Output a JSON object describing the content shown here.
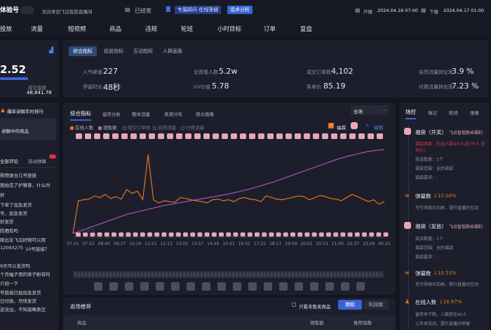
{
  "header": {
    "title": "体验号",
    "welcome": "欢迎来到飞瓜智投直播间",
    "status": "已结束",
    "tag_special": "专属顾问 在线答疑",
    "tag_analysis": "话术分析",
    "start_label": "开播",
    "start_time": "2024.04.16 07:00",
    "end_label": "下播",
    "end_time": "2024.04.17 01:00"
  },
  "nav": [
    "投放",
    "流量",
    "短视频",
    "商品",
    "违规",
    "轮班",
    "小时目标",
    "订单",
    "复盘"
  ],
  "left": {
    "big_value": "2.52",
    "sub_label": "GPM",
    "amount_label": "成交金额",
    "amount": "48,641.78",
    "rank_title": "爆单讲解实时排行",
    "explaining": "讲解中的商品",
    "comments_tab": "全部评论",
    "auto_tab": "自动弹幕",
    "comments": [
      "购物谁合几号链接",
      "我拍完了护臀膏，什么时",
      "好",
      "下单了加急发货",
      "号，加急发货",
      "好发货",
      "防晒有吗",
      "刚出生飞瓜好物可以用",
      "12093275",
      "10号链接？",
      "9天可以发货吗",
      "个月幅子用的痱子粉有吗",
      "介绍一下",
      "号链接已拍加急发货",
      "已付款，尽快发货",
      "还没出，不知道眯质怎"
    ]
  },
  "metrics": {
    "tabs": [
      "综合指标",
      "投放指标",
      "互动指标",
      "人群画像"
    ],
    "items": [
      {
        "label": "人气峰值",
        "value": "227"
      },
      {
        "label": "总观看人数",
        "value": "5.2w"
      },
      {
        "label": "成交订单数",
        "value": "4,102"
      },
      {
        "label": "自然流量转化率",
        "value": "3.9 %"
      },
      {
        "label": "停留时长",
        "value": "48秒"
      },
      {
        "label": "UV价值",
        "value": "5.78"
      },
      {
        "label": "客单价",
        "value": "85.19"
      },
      {
        "label": "付费流量转化率",
        "value": "7.23 %"
      }
    ]
  },
  "chart": {
    "tabs": [
      "综合指标",
      "留存分析",
      "整体流量",
      "来源分布",
      "观众画像"
    ],
    "select": "全场",
    "fudai_label": "福袋",
    "edit_label": "编辑",
    "legend": [
      {
        "name": "在线人数",
        "color": "#e0741f"
      },
      {
        "name": "销售额",
        "color": "#c65ad6"
      },
      {
        "name": "成交订单数",
        "color": "#5a6070"
      },
      {
        "name": "自然流量",
        "color": "#5a6070"
      },
      {
        "name": "付费流量",
        "color": "#5a6070"
      }
    ],
    "watermark": "飞瓜智投"
  },
  "chart_data": {
    "type": "line",
    "x_ticks": [
      "07:01",
      "07:53",
      "08:45",
      "09:37",
      "10:29",
      "11:21",
      "12:13",
      "13:05",
      "13:57",
      "14:49",
      "15:41",
      "16:33",
      "17:25",
      "18:17",
      "19:09",
      "20:01",
      "20:53",
      "21:45",
      "22:37",
      "23:29",
      "00:21"
    ],
    "series": [
      {
        "name": "在线人数",
        "values": [
          12,
          115,
          118,
          120,
          130,
          125,
          135,
          122,
          128,
          120,
          150,
          138,
          145,
          118,
          260,
          118,
          108,
          115,
          112,
          110,
          125,
          122,
          118,
          115,
          112,
          108,
          118,
          120,
          115,
          118,
          112,
          122,
          125,
          120,
          118,
          112,
          130,
          125,
          120,
          118,
          122,
          126,
          130,
          128,
          118,
          124,
          132,
          128,
          122,
          120,
          115,
          125,
          135,
          128,
          120,
          112,
          118,
          104,
          112
        ]
      },
      {
        "name": "销售额",
        "values": [
          12,
          18,
          24,
          30,
          36,
          42,
          48,
          54,
          60,
          66,
          72,
          76,
          80,
          84,
          88,
          92,
          96,
          100,
          103,
          106,
          109,
          112,
          115,
          118,
          121,
          124,
          127,
          130,
          133,
          136,
          140,
          144,
          148,
          152,
          157,
          162,
          167,
          172,
          178,
          184,
          190,
          196,
          202,
          208,
          214,
          220,
          226,
          232,
          238,
          244,
          249,
          254,
          258,
          262,
          266,
          270,
          272,
          274,
          276
        ]
      }
    ]
  },
  "recommend": {
    "title": "返场推荐",
    "unsold": "只看未售卖商品",
    "btn_hot": "爆款",
    "btn_profit": "利润款",
    "col_goods": "商品",
    "col_sales": "销售额",
    "col_index": "推荐指数"
  },
  "right": {
    "tabs": [
      "场控",
      "场记",
      "轮班",
      "录像"
    ],
    "events": [
      {
        "icon": "bag-icon",
        "title": "福袋（开奖）",
        "tag": "飞瓜智投粉丝福利",
        "lines": [
          "福袋效果：在线人数从0人减少0人 变化0人",
          "奖品数量：1个",
          "福袋范围：全民福袋",
          "福袋要求：-"
        ]
      },
      {
        "icon": "danmu-icon",
        "title": "弹幕数",
        "change": "↓10.00%",
        "lines": [
          "可引导观众扣屏，提升直播间互动"
        ]
      },
      {
        "icon": "bag-icon",
        "title": "福袋（发放）",
        "tag": "飞瓜智投粉丝福利",
        "lines": [
          "奖品数量：1个",
          "福袋范围：全民福袋",
          "福袋要求：-"
        ]
      },
      {
        "icon": "danmu-icon",
        "title": "弹幕数",
        "change": "↓10.53%",
        "lines": [
          "可引导观众扣屏，提升直播间互动"
        ]
      },
      {
        "icon": "people-icon",
        "title": "在线人数",
        "change": "↓16.67%",
        "lines": [
          "留存率下降，人数降至40人",
          "上外承流动，提升直播间停留"
        ]
      }
    ]
  }
}
